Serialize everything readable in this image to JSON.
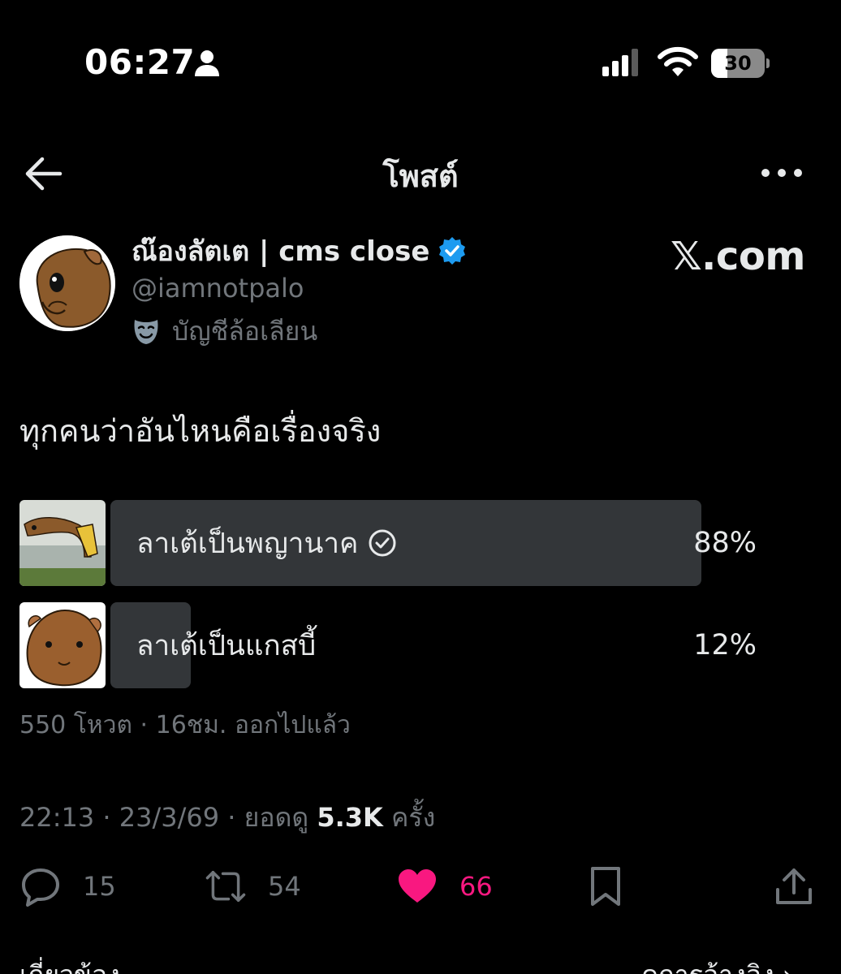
{
  "status_bar": {
    "time": "06:27",
    "battery_level": "30",
    "battery_fraction": 0.3,
    "icons": [
      "person-icon",
      "signal-icon",
      "wifi-icon",
      "battery-icon"
    ]
  },
  "header": {
    "title": "โพสต์",
    "back_icon": "arrow-left-icon",
    "more_icon": "ellipsis-icon"
  },
  "author": {
    "name": "ณ๊องลัตเต | cms close",
    "handle": "@iamnotpalo",
    "parody_label": "บัญชีล้อเลียน",
    "verified": true
  },
  "watermark": "𝕏.com",
  "post": {
    "text": "ทุกคนว่าอันไหนคือเรื่องจริง"
  },
  "poll": {
    "options": [
      {
        "label": "ลาเต้เป็นพญานาค",
        "percent_label": "88%",
        "percent": 88,
        "winner": true
      },
      {
        "label": "ลาเต้เป็นแกสบี้",
        "percent_label": "12%",
        "percent": 12,
        "winner": false
      }
    ],
    "meta": "550 โหวต · 16ชม. ออกไปแล้ว"
  },
  "post_meta": {
    "timestamp": "22:13 · 23/3/69 · ยอดดู ",
    "views": "5.3K",
    "views_suffix": " ครั้ง"
  },
  "actions": {
    "replies": "15",
    "reposts": "54",
    "likes": "66",
    "like_color": "#f91880"
  },
  "footer": {
    "left": "เกี่ยวข้อง ⌄",
    "right": "คการอ้างอิง ›"
  },
  "colors": {
    "background": "#000000",
    "text": "#e7e9ea",
    "secondary": "#71767b",
    "poll_bar": "#333639",
    "verified": "#1d9bf0",
    "like": "#f91880"
  }
}
